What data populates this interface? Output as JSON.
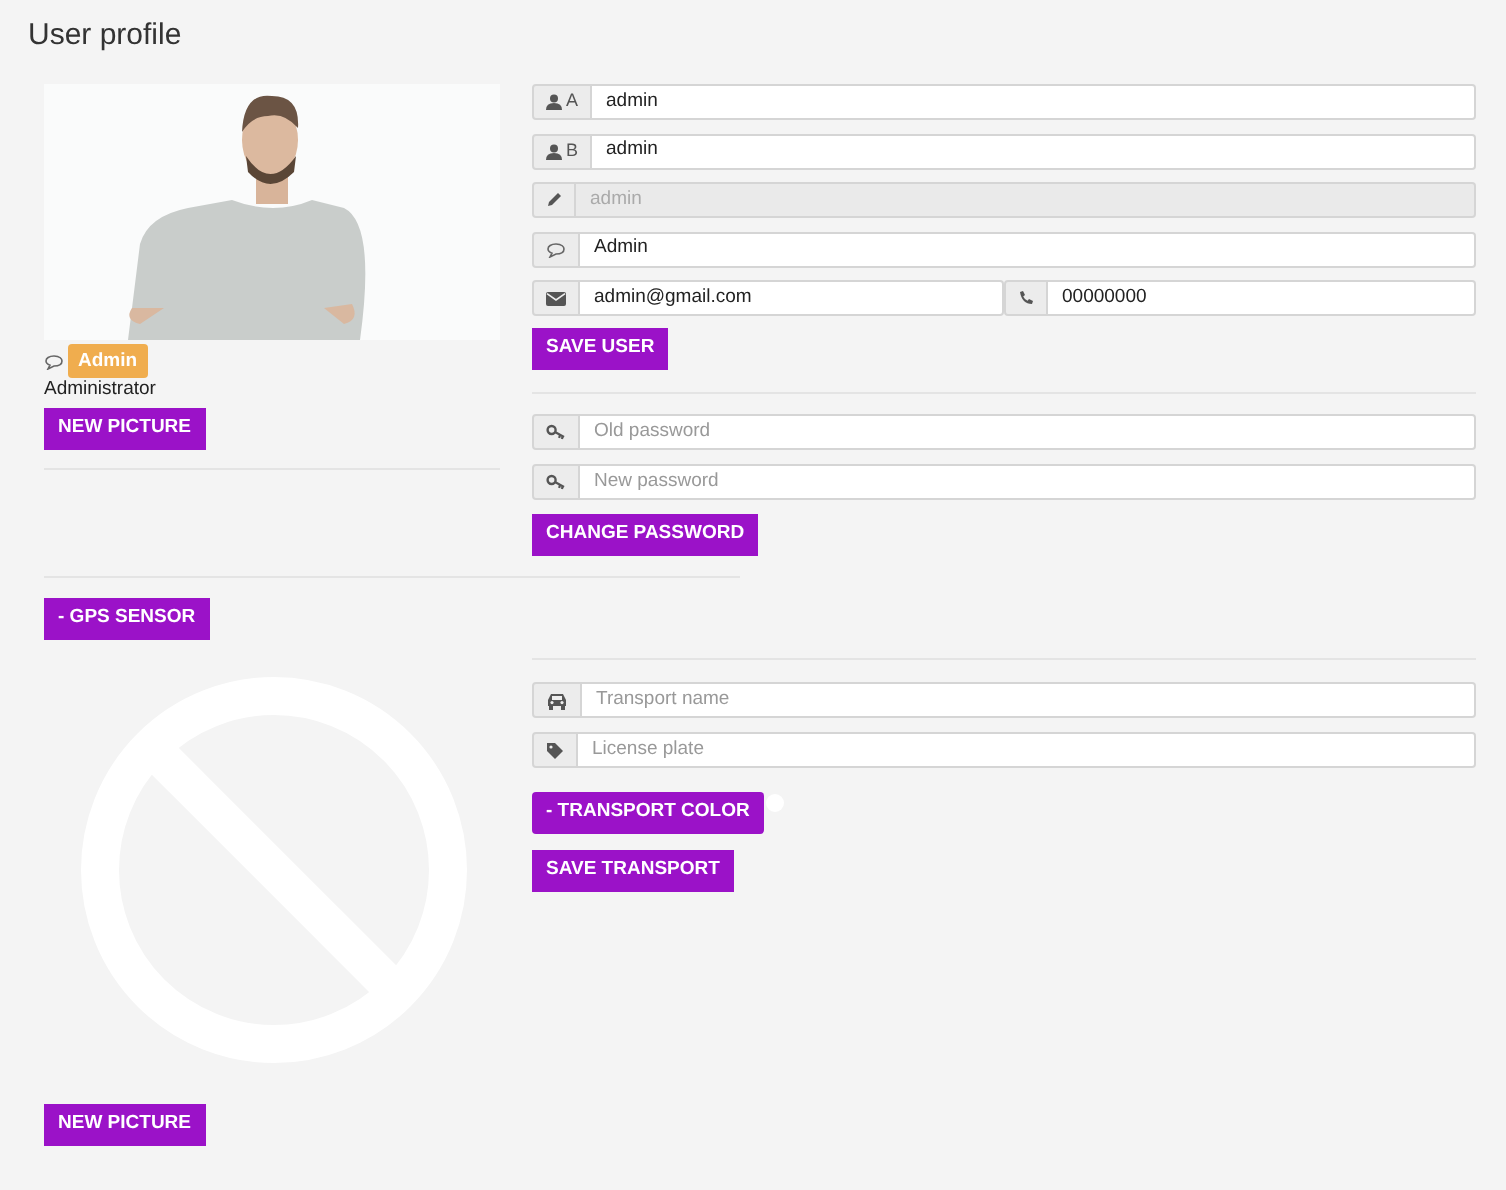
{
  "title": "User profile",
  "profile": {
    "role_badge": "Admin",
    "role_name": "Administrator",
    "new_picture_button": "NEW PICTURE"
  },
  "user_fields": [
    {
      "addon": "A",
      "value": "admin",
      "disabled": false
    },
    {
      "addon": "B",
      "value": "admin",
      "disabled": false
    },
    {
      "value": "admin",
      "disabled": true
    },
    {
      "value": "Admin",
      "disabled": false
    }
  ],
  "contact_fields": [
    {
      "value": "admin@gmail.com"
    },
    {
      "value": "00000000"
    }
  ],
  "save_user_button": "SAVE USER",
  "password_fields": [
    {
      "placeholder": "Old password"
    },
    {
      "placeholder": "New password"
    }
  ],
  "change_password_button": "CHANGE PASSWORD",
  "gps_button": "- GPS SENSOR",
  "transport": {
    "fields": [
      {
        "placeholder": "Transport name"
      },
      {
        "placeholder": "License plate"
      }
    ],
    "color_button": "- TRANSPORT COLOR",
    "save_button": "SAVE TRANSPORT",
    "new_picture_button": "NEW PICTURE"
  }
}
